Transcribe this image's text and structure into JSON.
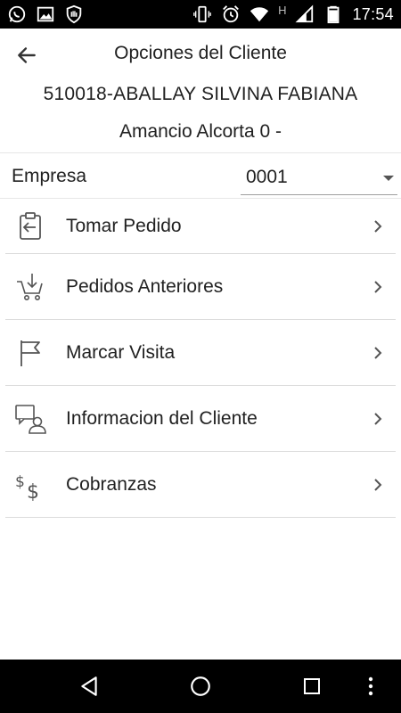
{
  "status_bar": {
    "time": "17:54",
    "h_indicator": "H",
    "left_icons": [
      "whatsapp-icon",
      "image-icon",
      "shield-hand-icon"
    ],
    "right_icons": [
      "vibrate-icon",
      "alarm-icon",
      "wifi-icon",
      "signal-icon",
      "battery-icon"
    ]
  },
  "header": {
    "title": "Opciones del Cliente",
    "client": "510018-ABALLAY SILVINA FABIANA",
    "address": "Amancio Alcorta 0  -"
  },
  "empresa": {
    "label": "Empresa",
    "value": "0001"
  },
  "menu": [
    {
      "label": "Tomar Pedido",
      "icon": "clipboard-arrow-icon"
    },
    {
      "label": "Pedidos Anteriores",
      "icon": "cart-download-icon"
    },
    {
      "label": "Marcar Visita",
      "icon": "flag-icon"
    },
    {
      "label": "Informacion del Cliente",
      "icon": "person-chat-icon"
    },
    {
      "label": "Cobranzas",
      "icon": "dollar-icon"
    }
  ],
  "nav": {
    "buttons": [
      "back-triangle-icon",
      "home-circle-icon",
      "recents-square-icon",
      "overflow-menu-icon"
    ]
  }
}
